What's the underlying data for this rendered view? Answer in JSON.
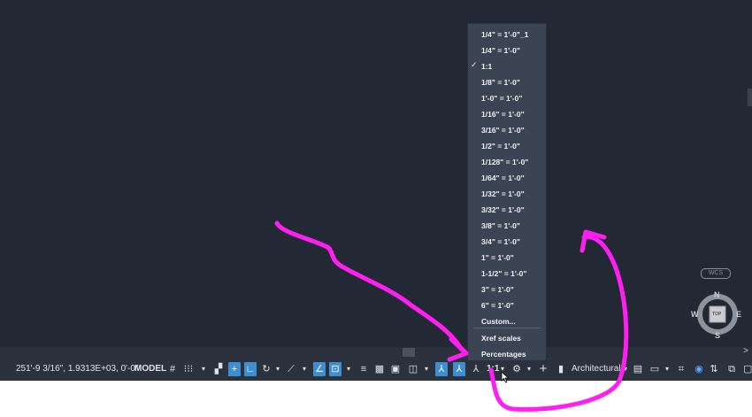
{
  "statusbar": {
    "coords": "251'-9 3/16\", 1.9313E+03, 0'-0\"",
    "model_label": "MODEL",
    "scale_value": "1:1",
    "units_label": "Architectural"
  },
  "scale_menu": {
    "selected": "1:1",
    "items": [
      "1/4\" = 1'-0\"_1",
      "1/4\" = 1'-0\"",
      "1:1",
      "1/8\" = 1'-0\"",
      "1'-0\" = 1'-0\"",
      "1/16\" = 1'-0\"",
      "3/16\" = 1'-0\"",
      "1/2\" = 1'-0\"",
      "1/128\" = 1'-0\"",
      "1/64\" = 1'-0\"",
      "1/32\" = 1'-0\"",
      "3/32\" = 1'-0\"",
      "3/8\" = 1'-0\"",
      "3/4\" = 1'-0\"",
      "1\" = 1'-0\"",
      "1-1/2\" = 1'-0\"",
      "3\" = 1'-0\"",
      "6\" = 1'-0\"",
      "Custom..."
    ],
    "footer_items": [
      "Xref scales",
      "Percentages"
    ],
    "checkmark": "✓"
  },
  "viewcube": {
    "wcs_label": "WCS",
    "top_label": "TOP",
    "north": "N",
    "south": "S",
    "east": "E",
    "west": "W"
  },
  "colors": {
    "canvas": "#222934",
    "menu": "#3b4453",
    "statusbar": "#2b323e",
    "toggle_on": "#3e8ed0",
    "annotation": "#ff1ff0"
  },
  "icons": [
    "grid-icon",
    "snap-icon",
    "ortho-icon",
    "polar-icon",
    "isodraft-icon",
    "osnap-icon",
    "dynamic-input-icon",
    "lineweight-icon",
    "transparency-icon",
    "annotation-visibility-icon",
    "auto-scale-icon",
    "annotation-scale-icon",
    "workspace-gear-icon",
    "crosshair-icon",
    "units-icon",
    "quick-properties-icon",
    "isolate-icon",
    "hardware-accel-icon",
    "clean-screen-icon"
  ]
}
